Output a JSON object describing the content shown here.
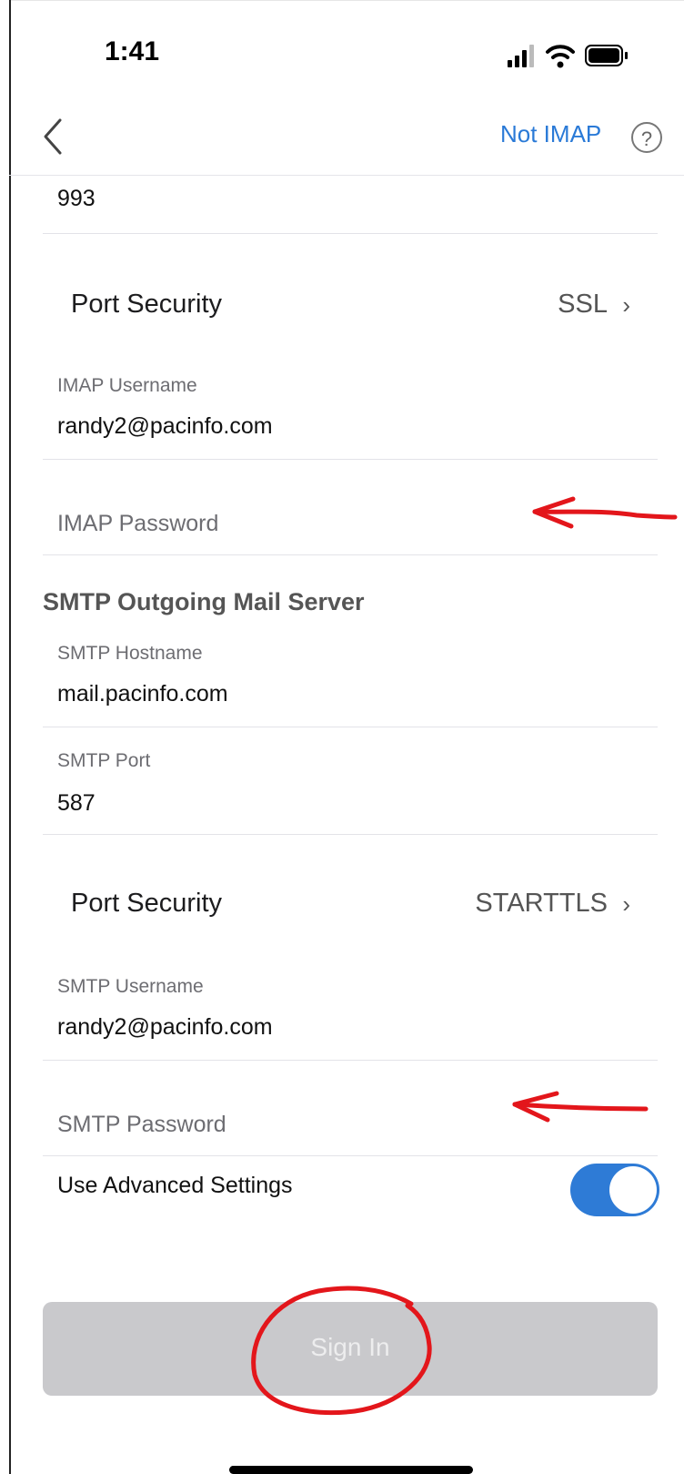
{
  "status_bar": {
    "time": "1:41",
    "icons": [
      "cellular-signal-icon",
      "wifi-icon",
      "battery-icon"
    ]
  },
  "nav": {
    "back_icon": "chevron-left-icon",
    "not_imap": "Not IMAP",
    "help_symbol": "?"
  },
  "imap": {
    "port_value": "993",
    "port_security": {
      "title": "Port Security",
      "value": "SSL",
      "chevron": "›"
    },
    "username": {
      "label": "IMAP Username",
      "value": "randy2@pacinfo.com"
    },
    "password": {
      "placeholder": "IMAP Password"
    }
  },
  "smtp": {
    "section_title": "SMTP Outgoing Mail Server",
    "hostname": {
      "label": "SMTP Hostname",
      "value": "mail.pacinfo.com"
    },
    "port": {
      "label": "SMTP Port",
      "value": "587"
    },
    "port_security": {
      "title": "Port Security",
      "value": "STARTTLS",
      "chevron": "›"
    },
    "username": {
      "label": "SMTP Username",
      "value": "randy2@pacinfo.com"
    },
    "password": {
      "placeholder": "SMTP Password"
    }
  },
  "advanced": {
    "label": "Use Advanced Settings",
    "enabled": true
  },
  "sign_in": {
    "label": "Sign In"
  },
  "colors": {
    "accent": "#2e7bd6",
    "link": "#2a7ad7",
    "annotation": "#e3161b",
    "disabled_button": "#c9c9cc"
  }
}
